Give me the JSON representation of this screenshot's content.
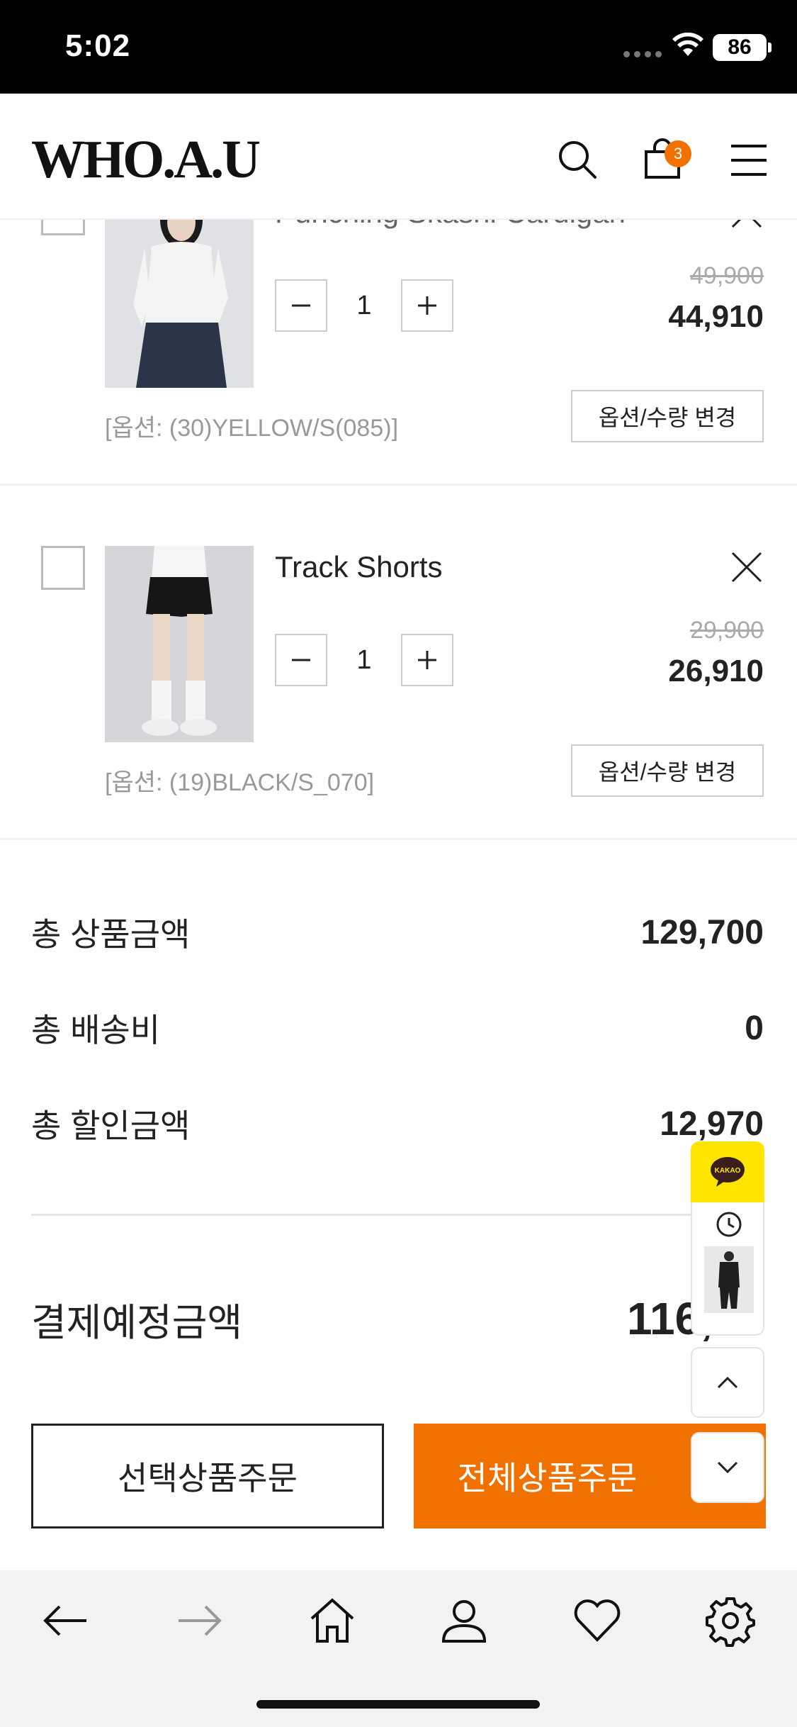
{
  "status": {
    "time": "5:02",
    "battery": "86"
  },
  "header": {
    "logo": "WHO.A.U",
    "cart_count": "3"
  },
  "items": [
    {
      "name": "Punching Skashi Cardigan",
      "quantity": "1",
      "original_price": "49,900",
      "sale_price": "44,910",
      "option": "[옵션: (30)YELLOW/S(085)]",
      "option_button": "옵션/수량 변경"
    },
    {
      "name": "Track Shorts",
      "quantity": "1",
      "original_price": "29,900",
      "sale_price": "26,910",
      "option": "[옵션: (19)BLACK/S_070]",
      "option_button": "옵션/수량 변경"
    }
  ],
  "summary": {
    "total_product_label": "총 상품금액",
    "total_product": "129,700",
    "shipping_label": "총 배송비",
    "shipping": "0",
    "discount_label": "총 할인금액",
    "discount": "12,970",
    "payment_label": "결제예정금액",
    "payment": "116,"
  },
  "buttons": {
    "order_selected": "선택상품주문",
    "order_all": "전체상품주문"
  },
  "float": {
    "kakao": "KAKAO"
  },
  "colors": {
    "accent": "#f07000",
    "kakao": "#fee500"
  }
}
